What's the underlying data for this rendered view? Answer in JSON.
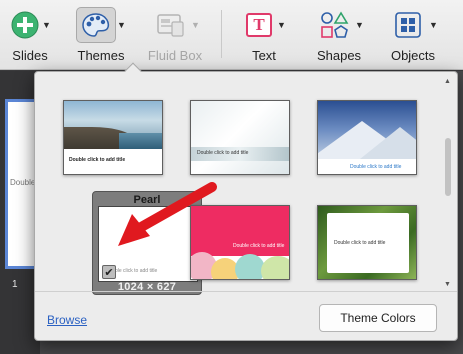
{
  "toolbar": {
    "items": [
      {
        "label": "Slides",
        "icon": "add-slide-icon"
      },
      {
        "label": "Themes",
        "icon": "palette-icon"
      },
      {
        "label": "Fluid Box",
        "icon": "fluid-box-icon"
      },
      {
        "label": "Text",
        "icon": "text-icon"
      },
      {
        "label": "Shapes",
        "icon": "shapes-icon"
      },
      {
        "label": "Objects",
        "icon": "objects-icon"
      }
    ],
    "text_icon_glyph": "T"
  },
  "slide_panel": {
    "slide_number": "1",
    "thumb_text": "Double"
  },
  "themes_popover": {
    "themes": [
      {
        "name": "",
        "title_text": "Double click to add title"
      },
      {
        "name": "",
        "title_text": "Double click to add title"
      },
      {
        "name": "",
        "title_text": "Double click to add title"
      },
      {
        "name": "Pearl",
        "title_text": "ble click to add title",
        "dimensions": "1024 × 627",
        "check_glyph": "✔"
      },
      {
        "name": "",
        "title_text": "Double click to add title"
      },
      {
        "name": "",
        "title_text": "Double click to add title"
      }
    ],
    "browse_label": "Browse",
    "theme_colors_label": "Theme Colors"
  },
  "colors": {
    "accent_blue": "#2b61c2",
    "selection_blue": "#5b86d6",
    "arrow_red": "#e0191f",
    "pink_theme": "#ee2c62"
  }
}
